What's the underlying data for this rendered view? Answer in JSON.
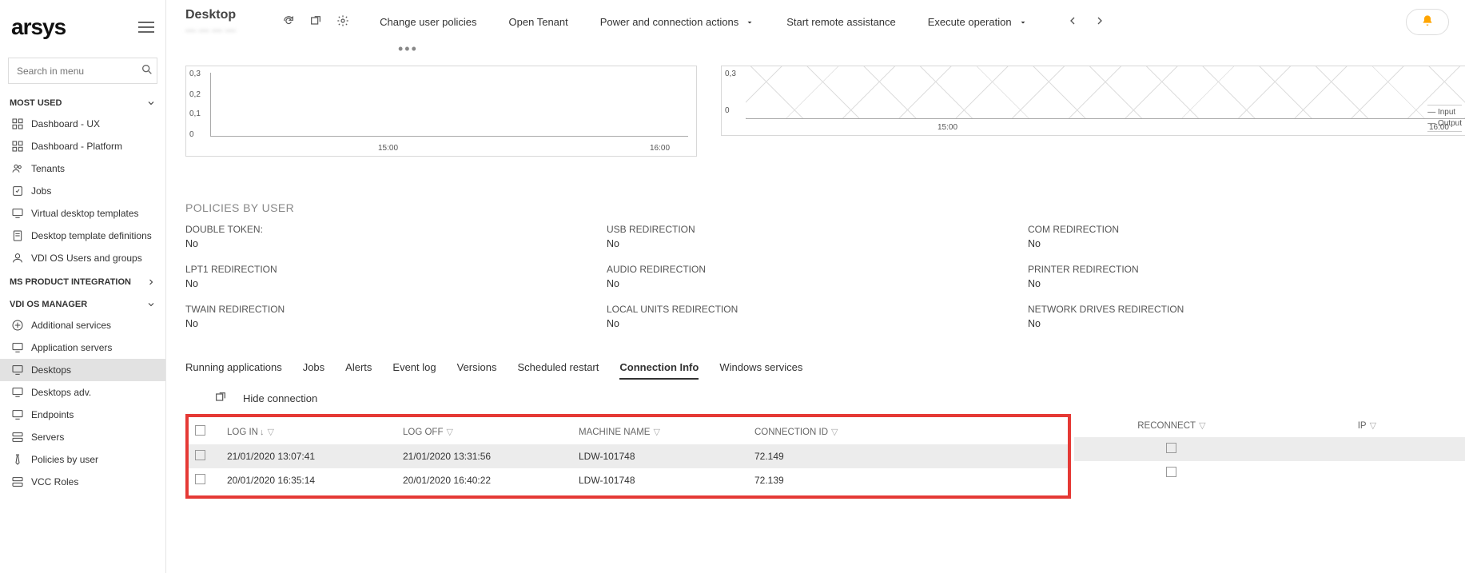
{
  "logo": "arsys",
  "search": {
    "placeholder": "Search in menu"
  },
  "sidebar": {
    "sections": [
      {
        "name": "MOST USED",
        "expanded": true,
        "items": [
          {
            "label": "Dashboard - UX",
            "icon": "dashboard-icon"
          },
          {
            "label": "Dashboard - Platform",
            "icon": "dashboard-icon"
          },
          {
            "label": "Tenants",
            "icon": "users-icon"
          },
          {
            "label": "Jobs",
            "icon": "jobs-icon"
          },
          {
            "label": "Virtual desktop templates",
            "icon": "monitor-icon"
          },
          {
            "label": "Desktop template definitions",
            "icon": "doc-icon"
          },
          {
            "label": "VDI OS Users and groups",
            "icon": "user-icon"
          }
        ]
      },
      {
        "name": "MS PRODUCT INTEGRATION",
        "expanded": false,
        "items": []
      },
      {
        "name": "VDI OS MANAGER",
        "expanded": true,
        "items": [
          {
            "label": "Additional services",
            "icon": "plus-circle-icon"
          },
          {
            "label": "Application servers",
            "icon": "monitor-icon"
          },
          {
            "label": "Desktops",
            "icon": "monitor-icon",
            "active": true
          },
          {
            "label": "Desktops adv.",
            "icon": "monitor-icon"
          },
          {
            "label": "Endpoints",
            "icon": "monitor-icon"
          },
          {
            "label": "Servers",
            "icon": "server-icon"
          },
          {
            "label": "Policies by user",
            "icon": "tie-icon"
          },
          {
            "label": "VCC Roles",
            "icon": "server-icon"
          }
        ]
      }
    ]
  },
  "header": {
    "title": "Desktop",
    "subtitle": "— — — —",
    "actions": [
      {
        "label": "Change user policies"
      },
      {
        "label": "Open Tenant"
      },
      {
        "label": "Power and connection actions",
        "dropdown": true
      },
      {
        "label": "Start remote assistance"
      },
      {
        "label": "Execute operation",
        "dropdown": true
      }
    ]
  },
  "chart_data": [
    {
      "type": "line",
      "series": [
        {
          "name": "",
          "values": [
            0,
            0,
            0,
            0
          ]
        }
      ],
      "x_ticks": [
        "15:00",
        "16:00"
      ],
      "y_ticks": [
        "0",
        "0,1",
        "0,2",
        "0,3"
      ],
      "ylim": [
        0,
        0.3
      ]
    },
    {
      "type": "line",
      "series": [
        {
          "name": "Input",
          "values": [
            0,
            0.3,
            0,
            0.3,
            0,
            0.3,
            0,
            0.3,
            0,
            0.3,
            0
          ]
        },
        {
          "name": "Output",
          "values": [
            0,
            0.3,
            0,
            0.3,
            0,
            0.3,
            0,
            0.3,
            0,
            0.3,
            0
          ]
        }
      ],
      "x_ticks": [
        "15:00",
        "16:00"
      ],
      "y_ticks": [
        "0",
        "0,3"
      ],
      "ylim": [
        0,
        0.3
      ],
      "legend": [
        "Input",
        "Output"
      ]
    }
  ],
  "policies": {
    "title": "POLICIES BY USER",
    "items": [
      {
        "label": "DOUBLE TOKEN:",
        "value": "No"
      },
      {
        "label": "USB REDIRECTION",
        "value": "No"
      },
      {
        "label": "COM REDIRECTION",
        "value": "No"
      },
      {
        "label": "LPT1 REDIRECTION",
        "value": "No"
      },
      {
        "label": "AUDIO REDIRECTION",
        "value": "No"
      },
      {
        "label": "PRINTER REDIRECTION",
        "value": "No"
      },
      {
        "label": "TWAIN REDIRECTION",
        "value": "No"
      },
      {
        "label": "LOCAL UNITS REDIRECTION",
        "value": "No"
      },
      {
        "label": "NETWORK DRIVES REDIRECTION",
        "value": "No"
      }
    ]
  },
  "tabs": [
    {
      "label": "Running applications"
    },
    {
      "label": "Jobs"
    },
    {
      "label": "Alerts"
    },
    {
      "label": "Event log"
    },
    {
      "label": "Versions"
    },
    {
      "label": "Scheduled restart"
    },
    {
      "label": "Connection Info",
      "active": true
    },
    {
      "label": "Windows services"
    }
  ],
  "tableToolbar": {
    "hide": "Hide connection"
  },
  "connTable": {
    "columns": [
      {
        "label": "LOG IN",
        "sort": true
      },
      {
        "label": "LOG OFF"
      },
      {
        "label": "MACHINE NAME"
      },
      {
        "label": "CONNECTION ID"
      }
    ],
    "extraColumns": [
      {
        "label": "RECONNECT"
      },
      {
        "label": "IP"
      }
    ],
    "rows": [
      {
        "login": "21/01/2020 13:07:41",
        "logoff": "21/01/2020 13:31:56",
        "machine": "LDW-101748",
        "cid": "72.149",
        "reconnect": false
      },
      {
        "login": "20/01/2020 16:35:14",
        "logoff": "20/01/2020 16:40:22",
        "machine": "LDW-101748",
        "cid": "72.139",
        "reconnect": false
      }
    ]
  }
}
